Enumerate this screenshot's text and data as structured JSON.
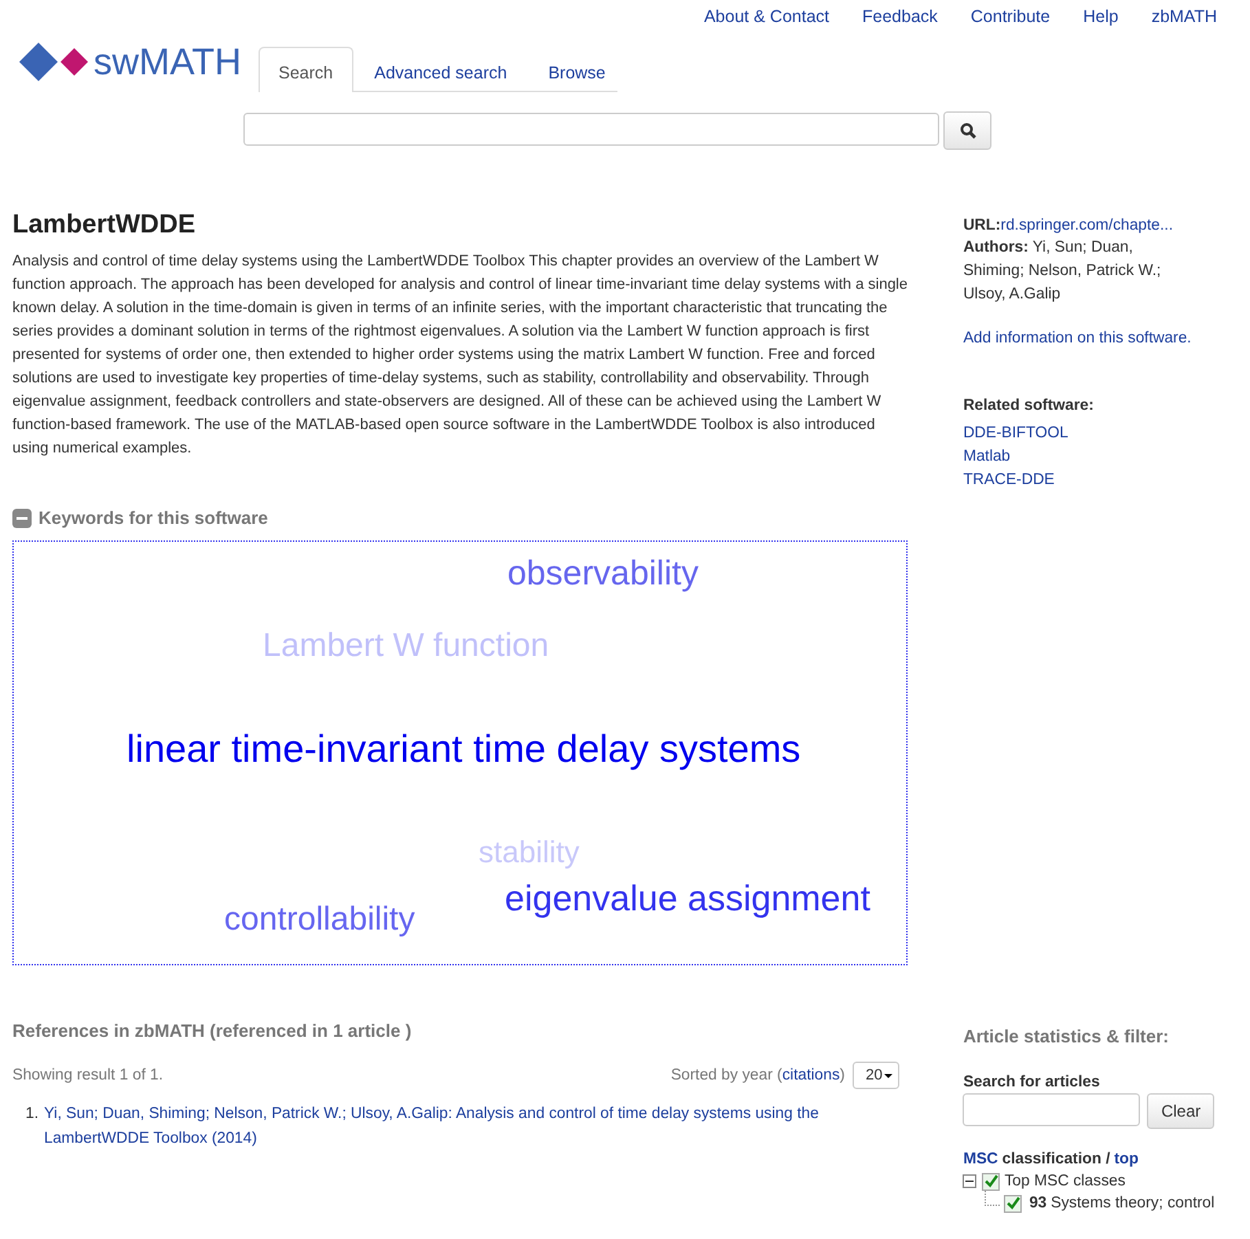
{
  "top_links": [
    "About & Contact",
    "Feedback",
    "Contribute",
    "Help",
    "zbMATH"
  ],
  "logo": {
    "text": "swMATH"
  },
  "tabs": [
    {
      "label": "Search",
      "selected": true
    },
    {
      "label": "Advanced search",
      "selected": false
    },
    {
      "label": "Browse",
      "selected": false
    }
  ],
  "software": {
    "title": "LambertWDDE",
    "description": "Analysis and control of time delay systems using the LambertWDDE Toolbox This chapter provides an overview of the Lambert W function approach. The approach has been developed for analysis and control of linear time-invariant time delay systems with a single known delay. A solution in the time-domain is given in terms of an infinite series, with the important characteristic that truncating the series provides a dominant solution in terms of the rightmost eigenvalues. A solution via the Lambert W function approach is first presented for systems of order one, then extended to higher order systems using the matrix Lambert W function. Free and forced solutions are used to investigate key properties of time-delay systems, such as stability, controllability and observability. Through eigenvalue assignment, feedback controllers and state-observers are designed. All of these can be achieved using the Lambert W function-based framework. The use of the MATLAB-based open source software in the LambertWDDE Toolbox is also introduced using numerical examples."
  },
  "info": {
    "url_label": "URL:",
    "url": "rd.springer.com/chapte...",
    "authors_label": "Authors:",
    "authors": "Yi, Sun; Duan, Shiming; Nelson, Patrick W.; Ulsoy, A.Galip",
    "add_info": "Add information on this software.",
    "related_title": "Related software:",
    "related": [
      "DDE-BIFTOOL",
      "Matlab",
      "TRACE-DDE"
    ]
  },
  "keywords": {
    "title": "Keywords for this software",
    "expanded": true,
    "items": [
      {
        "text": "observability",
        "color": "#6666ee"
      },
      {
        "text": "Lambert W function",
        "color": "#c0c0fa"
      },
      {
        "text": "linear time-invariant time delay systems",
        "color": "#0000ee"
      },
      {
        "text": "stability",
        "color": "#c8c8fa"
      },
      {
        "text": "eigenvalue assignment",
        "color": "#3333ee"
      },
      {
        "text": "controllability",
        "color": "#6666f0"
      }
    ]
  },
  "references": {
    "title": "References in zbMATH (referenced in 1 article )",
    "showing": "Showing result 1 of 1.",
    "sorted_by": "Sorted by year (",
    "sort_link": "citations",
    "sorted_end": ")",
    "page_size": "20",
    "items": [
      {
        "number": "1.",
        "text": "Yi, Sun; Duan, Shiming; Nelson, Patrick W.; Ulsoy, A.Galip: Analysis and control of time delay systems using the LambertWDDE Toolbox (2014)"
      }
    ]
  },
  "filter": {
    "title": "Article statistics & filter:",
    "search_label": "Search for articles",
    "clear": "Clear",
    "msc_link": "MSC",
    "msc_text": "classification /",
    "top_link": "top",
    "tree": [
      {
        "label": "Top MSC classes",
        "checked": true,
        "expanded": true,
        "children": [
          {
            "code": "93",
            "label": "Systems theory; control",
            "checked": true
          }
        ]
      }
    ]
  }
}
